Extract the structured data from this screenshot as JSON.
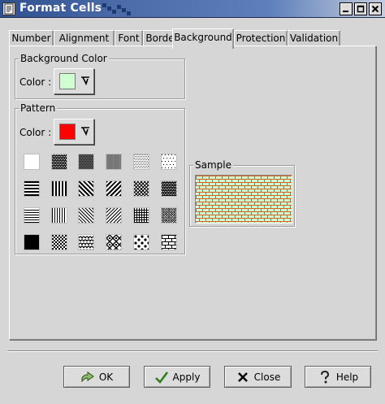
{
  "window": {
    "title": "Format Cells",
    "minimize": "_",
    "maximize": "□",
    "close": "×"
  },
  "tabs": [
    {
      "label": "Number"
    },
    {
      "label": "Alignment"
    },
    {
      "label": "Font"
    },
    {
      "label": "Border"
    },
    {
      "label": "Background",
      "active": true
    },
    {
      "label": "Protection"
    },
    {
      "label": "Validation"
    }
  ],
  "background_color": {
    "group_title": "Background Color",
    "label": "Color :",
    "value": "#cfffd2"
  },
  "pattern": {
    "group_title": "Pattern",
    "color_label": "Color :",
    "color_value": "#ff0000",
    "patterns": [
      [
        "solid-white",
        "dense-1",
        "dense-2",
        "dense-3",
        "dense-4",
        "dense-5"
      ],
      [
        "horizontal",
        "vertical",
        "back-diagonal",
        "diagonal",
        "cross",
        "diagonal-cross"
      ],
      [
        "thin-horizontal",
        "thin-vertical",
        "thin-back-diagonal",
        "thin-diagonal",
        "thin-cross",
        "thin-diagonal-cross"
      ],
      [
        "solid-black",
        "checker",
        "scales",
        "diamonds",
        "dots",
        "bricks"
      ]
    ]
  },
  "sample": {
    "group_title": "Sample",
    "pattern": "bricks",
    "background": "#cfffd2",
    "foreground": "#e05a1a"
  },
  "buttons": {
    "ok": "OK",
    "apply": "Apply",
    "close": "Close",
    "help": "Help"
  }
}
